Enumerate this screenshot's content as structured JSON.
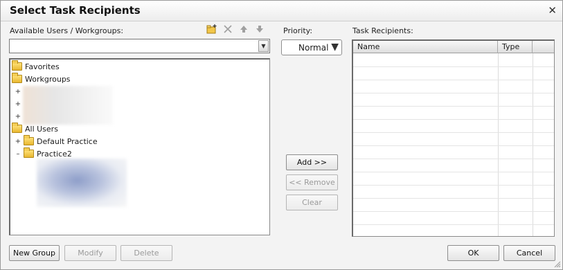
{
  "dialog": {
    "title": "Select Task Recipients",
    "close_glyph": "✕"
  },
  "left": {
    "label": "Available Users / Workgroups:",
    "toolbar": [
      {
        "icon": "new-folder-icon",
        "glyph": "📁"
      },
      {
        "icon": "delete-icon",
        "glyph": "✕"
      },
      {
        "icon": "arrow-up-icon",
        "glyph": "▲"
      },
      {
        "icon": "arrow-down-icon",
        "glyph": "▼"
      }
    ],
    "combo_value": "",
    "tree": {
      "favorites": "Favorites",
      "workgroups": "Workgroups",
      "all_users": "All Users",
      "default_practice": "Default Practice",
      "practice2": "Practice2",
      "expand_plus": "+",
      "expand_minus": "–"
    }
  },
  "priority": {
    "label": "Priority:",
    "value": "Normal"
  },
  "buttons": {
    "add": "Add >>",
    "remove": "<< Remove",
    "clear": "Clear",
    "new_group": "New Group",
    "modify": "Modify",
    "delete": "Delete",
    "ok": "OK",
    "cancel": "Cancel"
  },
  "recipients": {
    "label": "Task Recipients:",
    "columns": [
      "Name",
      "Type"
    ]
  }
}
